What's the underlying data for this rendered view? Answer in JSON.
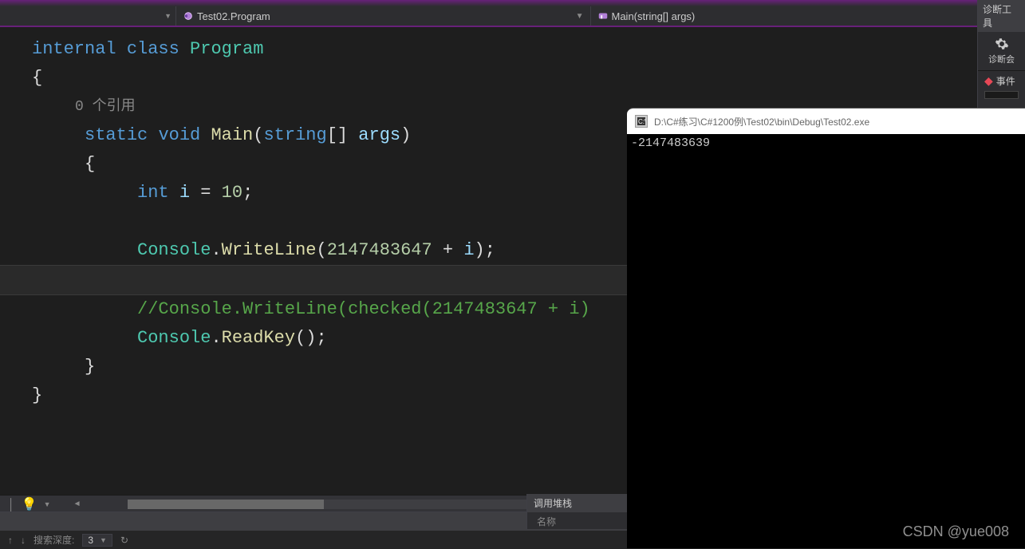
{
  "topbar": {
    "diagnostics_label": "诊断工具",
    "diagnostics_session": "诊断会",
    "events_label": "事件"
  },
  "nav": {
    "class_dropdown": "Test02.Program",
    "method_dropdown": "Main(string[] args)"
  },
  "code": {
    "l1_internal": "internal",
    "l1_class": "class",
    "l1_name": "Program",
    "brace_open": "{",
    "codelens_refs": "0 个引用",
    "l4_static": "static",
    "l4_void": "void",
    "l4_main": "Main",
    "l4_string": "string",
    "l4_brackets": "[]",
    "l4_args": "args",
    "l6_int": "int",
    "l6_var": "i",
    "l6_eq": " = ",
    "l6_val": "10",
    "console_cls": "Console",
    "dot": ".",
    "writeline": "WriteLine",
    "l8_num": "2147483647",
    "l8_plus": " + ",
    "comment_line": "//Console.WriteLine(checked(2147483647 + i)",
    "readkey": "ReadKey",
    "brace_close": "}",
    "semicolon": ";",
    "paren_open": "(",
    "paren_close": ")"
  },
  "console": {
    "title": "D:\\C#练习\\C#1200例\\Test02\\bin\\Debug\\Test02.exe",
    "output": "-2147483639"
  },
  "panels": {
    "callstack_title": "调用堆栈",
    "callstack_name": "名称",
    "search_depth_label": "搜索深度:",
    "search_depth_value": "3"
  },
  "watermark": "CSDN @yue008"
}
